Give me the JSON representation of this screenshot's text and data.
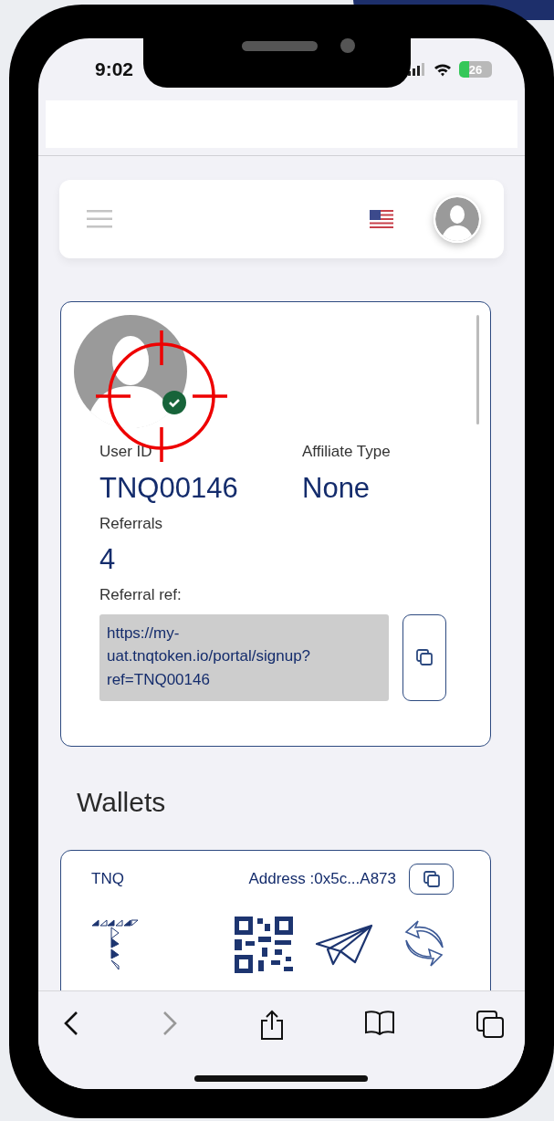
{
  "status_bar": {
    "time": "9:02",
    "battery": "26"
  },
  "profile": {
    "verified": true,
    "fields": [
      {
        "label": "User ID",
        "value": "TNQ00146"
      },
      {
        "label": "Affiliate Type",
        "value": "None"
      },
      {
        "label": "Referrals",
        "value": "4"
      }
    ],
    "referral_label": "Referral ref:",
    "referral_url": "https://my-uat.tnqtoken.io/portal/signup?ref=TNQ00146"
  },
  "wallets_title": "Wallets",
  "wallets": [
    {
      "symbol": "TNQ",
      "address": "Address :0x5c...A873"
    }
  ],
  "browser_toolbar": {
    "back_disabled": false,
    "forward_disabled": true
  }
}
